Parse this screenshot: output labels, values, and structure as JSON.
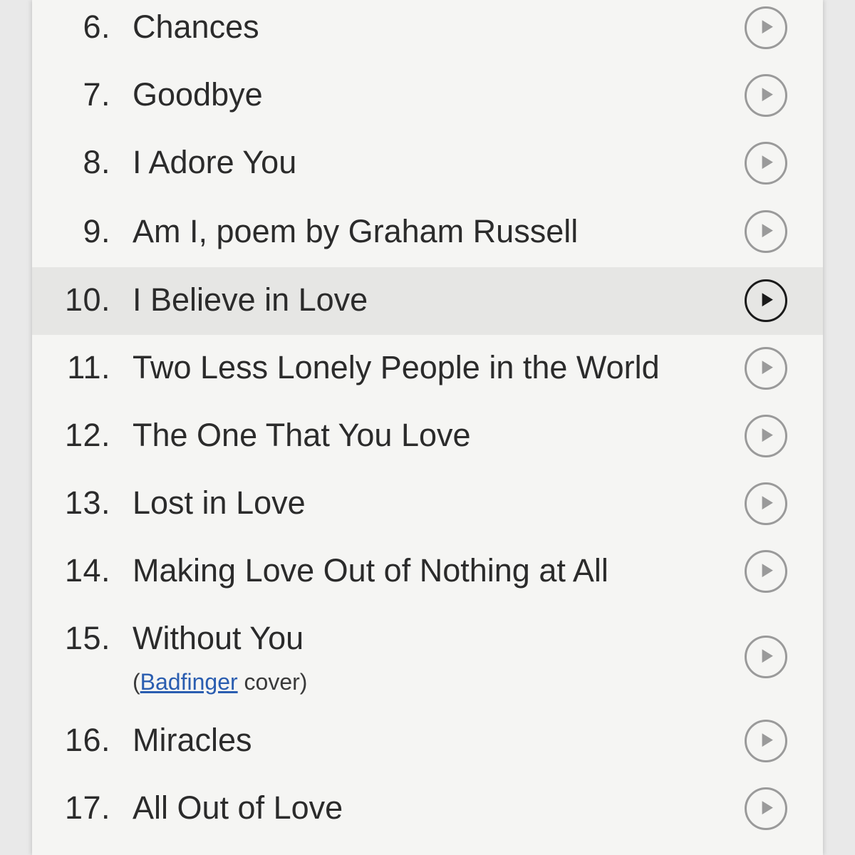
{
  "tracks": [
    {
      "number": "6.",
      "title": "Chances"
    },
    {
      "number": "7.",
      "title": "Goodbye"
    },
    {
      "number": "8.",
      "title": "I Adore You"
    },
    {
      "number": "9.",
      "title": "Am I, poem by Graham Russell"
    },
    {
      "number": "10.",
      "title": "I Believe in Love",
      "selected": true
    },
    {
      "number": "11.",
      "title": "Two Less Lonely People in the World"
    },
    {
      "number": "12.",
      "title": "The One That You Love"
    },
    {
      "number": "13.",
      "title": "Lost in Love"
    },
    {
      "number": "14.",
      "title": "Making Love Out of Nothing at All"
    },
    {
      "number": "15.",
      "title": "Without You",
      "note": {
        "open": "(",
        "link": "Badfinger",
        "rest": " cover)"
      }
    },
    {
      "number": "16.",
      "title": "Miracles"
    },
    {
      "number": "17.",
      "title": "All Out of Love"
    }
  ],
  "icons": {
    "play": "play-circle-icon"
  },
  "colors": {
    "link": "#2a5db0",
    "play_inactive": "#9a9a9a",
    "play_active": "#1a1a1a",
    "selected_row": "#e6e6e4"
  }
}
